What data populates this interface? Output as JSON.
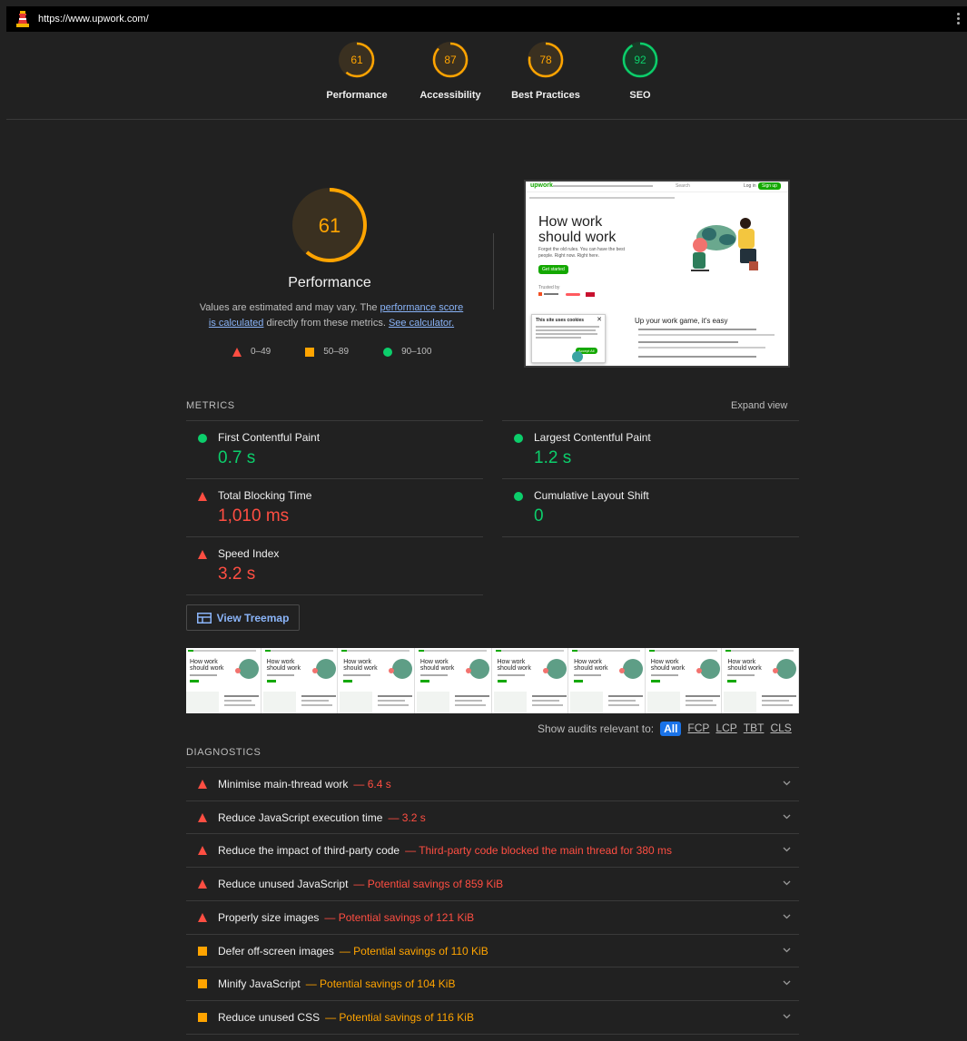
{
  "url": "https://www.upwork.com/",
  "scores": [
    {
      "label": "Performance",
      "value": "61",
      "color": "#ffa400",
      "fraction": 0.61
    },
    {
      "label": "Accessibility",
      "value": "87",
      "color": "#ffa400",
      "fraction": 0.87
    },
    {
      "label": "Best Practices",
      "value": "78",
      "color": "#ffa400",
      "fraction": 0.78
    },
    {
      "label": "SEO",
      "value": "92",
      "color": "#0cce6b",
      "fraction": 0.92
    }
  ],
  "performance": {
    "score": "61",
    "fraction": 0.61,
    "title": "Performance",
    "desc_1": "Values are estimated and may vary. The ",
    "link_1": "performance score is calculated",
    "desc_2": " directly from these metrics. ",
    "link_2": "See calculator."
  },
  "legend": {
    "fail": "0–49",
    "average": "50–89",
    "pass": "90–100"
  },
  "screenshot": {
    "logo": "upwork",
    "headline_1": "How work",
    "headline_2": "should work",
    "subtext": "Forget the old rules. You can have the best people. Right now. Right here.",
    "cta": "Get started",
    "trusted": "Trusted by",
    "section_title": "Up your work game, it's easy",
    "cookie_title": "This site uses cookies",
    "cookie_btn": "Accept All",
    "search": "Search",
    "login": "Log in",
    "signup": "Sign up"
  },
  "metrics_label": "METRICS",
  "expand_label": "Expand view",
  "metrics": [
    {
      "name": "First Contentful Paint",
      "value": "0.7 s",
      "status": "pass"
    },
    {
      "name": "Largest Contentful Paint",
      "value": "1.2 s",
      "status": "pass"
    },
    {
      "name": "Total Blocking Time",
      "value": "1,010 ms",
      "status": "fail"
    },
    {
      "name": "Cumulative Layout Shift",
      "value": "0",
      "status": "pass"
    },
    {
      "name": "Speed Index",
      "value": "3.2 s",
      "status": "fail"
    }
  ],
  "treemap_label": "View Treemap",
  "filmstrip_headline_1": "How work",
  "filmstrip_headline_2": "should work",
  "filter": {
    "label": "Show audits relevant to:",
    "options": [
      "All",
      "FCP",
      "LCP",
      "TBT",
      "CLS"
    ],
    "active": "All"
  },
  "diagnostics_label": "DIAGNOSTICS",
  "audits": [
    {
      "title": "Minimise main-thread work",
      "display": "— 6.4 s",
      "status": "fail"
    },
    {
      "title": "Reduce JavaScript execution time",
      "display": "— 3.2 s",
      "status": "fail"
    },
    {
      "title": "Reduce the impact of third-party code",
      "display": "— Third-party code blocked the main thread for 380 ms",
      "status": "fail"
    },
    {
      "title": "Reduce unused JavaScript",
      "display": "— Potential savings of 859 KiB",
      "status": "fail"
    },
    {
      "title": "Properly size images",
      "display": "— Potential savings of 121 KiB",
      "status": "fail"
    },
    {
      "title": "Defer off-screen images",
      "display": "— Potential savings of 110 KiB",
      "status": "average"
    },
    {
      "title": "Minify JavaScript",
      "display": "— Potential savings of 104 KiB",
      "status": "average"
    },
    {
      "title": "Reduce unused CSS",
      "display": "— Potential savings of 116 KiB",
      "status": "average"
    }
  ]
}
